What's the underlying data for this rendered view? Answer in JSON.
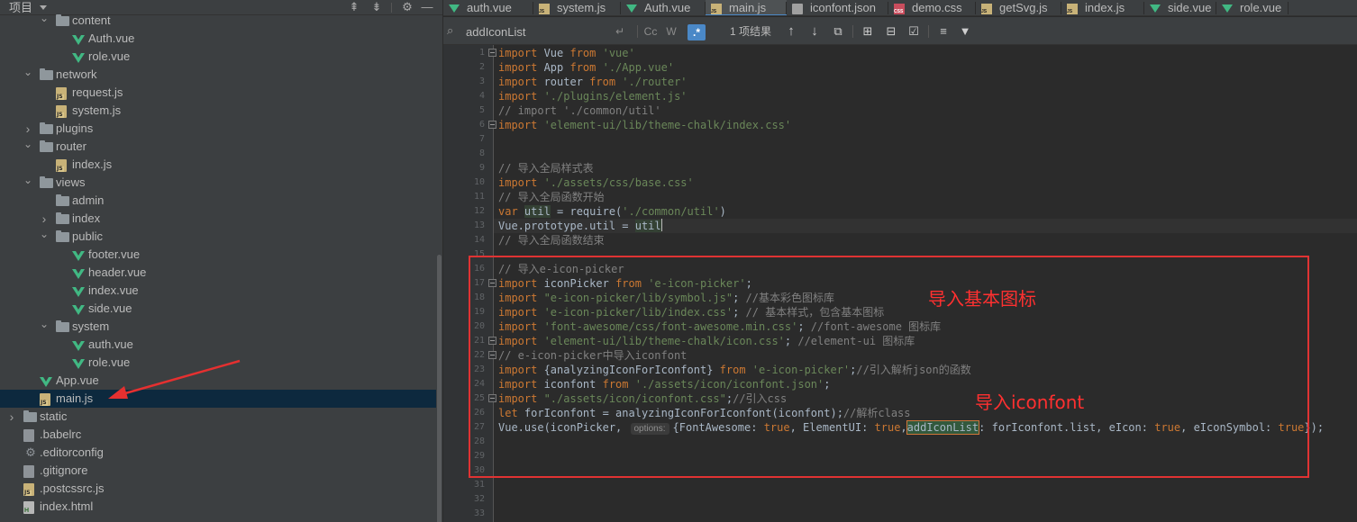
{
  "project_panel": {
    "title": "项目",
    "tree": [
      {
        "label": "content",
        "icon": "folder",
        "depth": 2,
        "expanded": true,
        "partial": true
      },
      {
        "label": "Auth.vue",
        "icon": "vue",
        "depth": 3
      },
      {
        "label": "role.vue",
        "icon": "vue",
        "depth": 3
      },
      {
        "label": "network",
        "icon": "folder",
        "depth": 1,
        "expanded": true
      },
      {
        "label": "request.js",
        "icon": "js",
        "depth": 2
      },
      {
        "label": "system.js",
        "icon": "js",
        "depth": 2
      },
      {
        "label": "plugins",
        "icon": "folder",
        "depth": 1,
        "expanded": false
      },
      {
        "label": "router",
        "icon": "folder",
        "depth": 1,
        "expanded": true
      },
      {
        "label": "index.js",
        "icon": "js",
        "depth": 2
      },
      {
        "label": "views",
        "icon": "folder",
        "depth": 1,
        "expanded": true
      },
      {
        "label": "admin",
        "icon": "folder",
        "depth": 2,
        "leaf": true
      },
      {
        "label": "index",
        "icon": "folder",
        "depth": 2,
        "expanded": false
      },
      {
        "label": "public",
        "icon": "folder",
        "depth": 2,
        "expanded": true
      },
      {
        "label": "footer.vue",
        "icon": "vue",
        "depth": 3
      },
      {
        "label": "header.vue",
        "icon": "vue",
        "depth": 3
      },
      {
        "label": "index.vue",
        "icon": "vue",
        "depth": 3
      },
      {
        "label": "side.vue",
        "icon": "vue",
        "depth": 3
      },
      {
        "label": "system",
        "icon": "folder",
        "depth": 2,
        "expanded": true
      },
      {
        "label": "auth.vue",
        "icon": "vue",
        "depth": 3
      },
      {
        "label": "role.vue",
        "icon": "vue",
        "depth": 3
      },
      {
        "label": "App.vue",
        "icon": "vue",
        "depth": 1
      },
      {
        "label": "main.js",
        "icon": "js",
        "depth": 1,
        "selected": true
      },
      {
        "label": "static",
        "icon": "folder",
        "depth": 0,
        "expanded": false
      },
      {
        "label": ".babelrc",
        "icon": "cfg",
        "depth": 0
      },
      {
        "label": ".editorconfig",
        "icon": "gear",
        "depth": 0
      },
      {
        "label": ".gitignore",
        "icon": "cfg",
        "depth": 0
      },
      {
        "label": ".postcssrc.js",
        "icon": "js",
        "depth": 0
      },
      {
        "label": "index.html",
        "icon": "html",
        "depth": 0
      }
    ]
  },
  "tabs": [
    {
      "label": "auth.vue",
      "icon": "vue"
    },
    {
      "label": "system.js",
      "icon": "js"
    },
    {
      "label": "Auth.vue",
      "icon": "vue"
    },
    {
      "label": "main.js",
      "icon": "js",
      "active": true
    },
    {
      "label": "iconfont.json",
      "icon": "json"
    },
    {
      "label": "demo.css",
      "icon": "css"
    },
    {
      "label": "getSvg.js",
      "icon": "js"
    },
    {
      "label": "index.js",
      "icon": "js"
    },
    {
      "label": "side.vue",
      "icon": "vue"
    },
    {
      "label": "role.vue",
      "icon": "vue"
    }
  ],
  "search": {
    "value": "addIconList",
    "match_case": "Cc",
    "words": "W",
    "regex": ".*",
    "result_count": "1 项结果"
  },
  "editor": {
    "caret_line": 13,
    "lines": [
      [
        [
          "kw",
          "import "
        ],
        [
          "",
          "Vue "
        ],
        [
          "kw",
          "from "
        ],
        [
          "str",
          "'vue'"
        ]
      ],
      [
        [
          "kw",
          "import "
        ],
        [
          "",
          "App "
        ],
        [
          "kw",
          "from "
        ],
        [
          "str",
          "'./App.vue'"
        ]
      ],
      [
        [
          "kw",
          "import "
        ],
        [
          "",
          "router "
        ],
        [
          "kw",
          "from "
        ],
        [
          "str",
          "'./router'"
        ]
      ],
      [
        [
          "kw",
          "import "
        ],
        [
          "str",
          "'./plugins/element.js'"
        ]
      ],
      [
        [
          "cm",
          "// import './common/util'"
        ]
      ],
      [
        [
          "kw",
          "import "
        ],
        [
          "str",
          "'element-ui/lib/theme-chalk/index.css'"
        ]
      ],
      [],
      [],
      [
        [
          "cm",
          "// 导入全局样式表"
        ]
      ],
      [
        [
          "kw",
          "import "
        ],
        [
          "str",
          "'./assets/css/base.css'"
        ]
      ],
      [
        [
          "cm",
          "// 导入全局函数开始"
        ]
      ],
      [
        [
          "kw",
          "var "
        ],
        [
          "hlvar",
          "util"
        ],
        [
          "",
          " = require("
        ],
        [
          "str",
          "'./common/util'"
        ],
        [
          "",
          ")"
        ]
      ],
      [
        [
          "",
          "Vue.prototype.util = "
        ],
        [
          "hlvar",
          "util"
        ],
        [
          "cursor",
          ""
        ]
      ],
      [
        [
          "cm",
          "// 导入全局函数结束"
        ]
      ],
      [],
      [
        [
          "cm",
          "// 导入e-icon-picker"
        ]
      ],
      [
        [
          "kw",
          "import "
        ],
        [
          "",
          "iconPicker "
        ],
        [
          "kw",
          "from "
        ],
        [
          "str",
          "'e-icon-picker'"
        ],
        [
          "",
          ";"
        ]
      ],
      [
        [
          "kw",
          "import "
        ],
        [
          "str",
          "\"e-icon-picker/lib/symbol.js\""
        ],
        [
          "",
          "; "
        ],
        [
          "cm",
          "//基本彩色图标库"
        ]
      ],
      [
        [
          "kw",
          "import "
        ],
        [
          "str",
          "'e-icon-picker/lib/index.css'"
        ],
        [
          "",
          "; "
        ],
        [
          "cm",
          "// 基本样式，包含基本图标"
        ]
      ],
      [
        [
          "kw",
          "import "
        ],
        [
          "str",
          "'font-awesome/css/font-awesome.min.css'"
        ],
        [
          "",
          "; "
        ],
        [
          "cm",
          "//font-awesome 图标库"
        ]
      ],
      [
        [
          "kw",
          "import "
        ],
        [
          "str",
          "'element-ui/lib/theme-chalk/icon.css'"
        ],
        [
          "",
          "; "
        ],
        [
          "cm",
          "//element-ui 图标库"
        ]
      ],
      [
        [
          "cm",
          "// e-icon-picker中导入iconfont"
        ]
      ],
      [
        [
          "kw",
          "import "
        ],
        [
          "",
          "{analyzingIconForIconfont} "
        ],
        [
          "kw",
          "from "
        ],
        [
          "str",
          "'e-icon-picker'"
        ],
        [
          "",
          ";"
        ],
        [
          "cm",
          "//引入解析json的函数"
        ]
      ],
      [
        [
          "kw",
          "import "
        ],
        [
          "",
          "iconfont "
        ],
        [
          "kw",
          "from "
        ],
        [
          "str",
          "'./assets/icon/iconfont.json'"
        ],
        [
          "",
          ";"
        ]
      ],
      [
        [
          "kw",
          "import "
        ],
        [
          "str",
          "\"./assets/icon/iconfont.css\""
        ],
        [
          "",
          ";"
        ],
        [
          "cm",
          "//引入css"
        ]
      ],
      [
        [
          "kw",
          "let "
        ],
        [
          "",
          "forIconfont = analyzingIconForIconfont(iconfont);"
        ],
        [
          "cm",
          "//解析class"
        ]
      ],
      [
        [
          "",
          "Vue.use(iconPicker, "
        ],
        [
          "hint",
          "options:"
        ],
        [
          "",
          "{FontAwesome: "
        ],
        [
          "kw",
          "true"
        ],
        [
          "",
          ", ElementUI: "
        ],
        [
          "kw",
          "true"
        ],
        [
          "",
          ","
        ],
        [
          "hl",
          "addIconList"
        ],
        [
          "",
          ": forIconfont.list, eIcon: "
        ],
        [
          "kw",
          "true"
        ],
        [
          "",
          ", eIconSymbol: "
        ],
        [
          "kw",
          "true"
        ],
        [
          "",
          "});"
        ]
      ],
      [],
      [],
      [],
      [],
      [],
      []
    ]
  },
  "annotations": {
    "basic_icons": "导入基本图标",
    "iconfont": "导入iconfont"
  },
  "colors": {
    "keyword": "#cc7832",
    "string": "#6a8759",
    "comment": "#808080",
    "annotation": "#ff3030",
    "selection": "#0d293e",
    "accent": "#4a88c7"
  }
}
